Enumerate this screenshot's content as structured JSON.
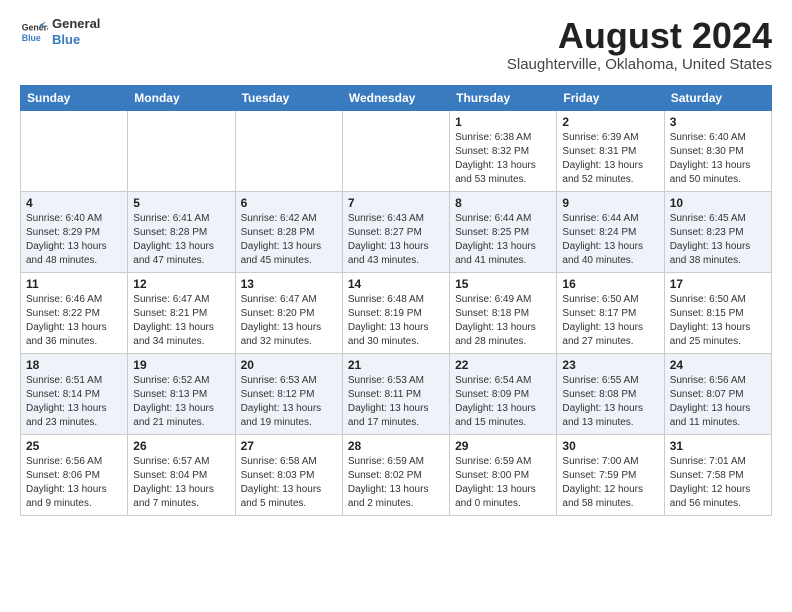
{
  "header": {
    "logo_line1": "General",
    "logo_line2": "Blue",
    "month_year": "August 2024",
    "location": "Slaughterville, Oklahoma, United States"
  },
  "weekdays": [
    "Sunday",
    "Monday",
    "Tuesday",
    "Wednesday",
    "Thursday",
    "Friday",
    "Saturday"
  ],
  "weeks": [
    [
      {
        "day": "",
        "info": ""
      },
      {
        "day": "",
        "info": ""
      },
      {
        "day": "",
        "info": ""
      },
      {
        "day": "",
        "info": ""
      },
      {
        "day": "1",
        "info": "Sunrise: 6:38 AM\nSunset: 8:32 PM\nDaylight: 13 hours\nand 53 minutes."
      },
      {
        "day": "2",
        "info": "Sunrise: 6:39 AM\nSunset: 8:31 PM\nDaylight: 13 hours\nand 52 minutes."
      },
      {
        "day": "3",
        "info": "Sunrise: 6:40 AM\nSunset: 8:30 PM\nDaylight: 13 hours\nand 50 minutes."
      }
    ],
    [
      {
        "day": "4",
        "info": "Sunrise: 6:40 AM\nSunset: 8:29 PM\nDaylight: 13 hours\nand 48 minutes."
      },
      {
        "day": "5",
        "info": "Sunrise: 6:41 AM\nSunset: 8:28 PM\nDaylight: 13 hours\nand 47 minutes."
      },
      {
        "day": "6",
        "info": "Sunrise: 6:42 AM\nSunset: 8:28 PM\nDaylight: 13 hours\nand 45 minutes."
      },
      {
        "day": "7",
        "info": "Sunrise: 6:43 AM\nSunset: 8:27 PM\nDaylight: 13 hours\nand 43 minutes."
      },
      {
        "day": "8",
        "info": "Sunrise: 6:44 AM\nSunset: 8:25 PM\nDaylight: 13 hours\nand 41 minutes."
      },
      {
        "day": "9",
        "info": "Sunrise: 6:44 AM\nSunset: 8:24 PM\nDaylight: 13 hours\nand 40 minutes."
      },
      {
        "day": "10",
        "info": "Sunrise: 6:45 AM\nSunset: 8:23 PM\nDaylight: 13 hours\nand 38 minutes."
      }
    ],
    [
      {
        "day": "11",
        "info": "Sunrise: 6:46 AM\nSunset: 8:22 PM\nDaylight: 13 hours\nand 36 minutes."
      },
      {
        "day": "12",
        "info": "Sunrise: 6:47 AM\nSunset: 8:21 PM\nDaylight: 13 hours\nand 34 minutes."
      },
      {
        "day": "13",
        "info": "Sunrise: 6:47 AM\nSunset: 8:20 PM\nDaylight: 13 hours\nand 32 minutes."
      },
      {
        "day": "14",
        "info": "Sunrise: 6:48 AM\nSunset: 8:19 PM\nDaylight: 13 hours\nand 30 minutes."
      },
      {
        "day": "15",
        "info": "Sunrise: 6:49 AM\nSunset: 8:18 PM\nDaylight: 13 hours\nand 28 minutes."
      },
      {
        "day": "16",
        "info": "Sunrise: 6:50 AM\nSunset: 8:17 PM\nDaylight: 13 hours\nand 27 minutes."
      },
      {
        "day": "17",
        "info": "Sunrise: 6:50 AM\nSunset: 8:15 PM\nDaylight: 13 hours\nand 25 minutes."
      }
    ],
    [
      {
        "day": "18",
        "info": "Sunrise: 6:51 AM\nSunset: 8:14 PM\nDaylight: 13 hours\nand 23 minutes."
      },
      {
        "day": "19",
        "info": "Sunrise: 6:52 AM\nSunset: 8:13 PM\nDaylight: 13 hours\nand 21 minutes."
      },
      {
        "day": "20",
        "info": "Sunrise: 6:53 AM\nSunset: 8:12 PM\nDaylight: 13 hours\nand 19 minutes."
      },
      {
        "day": "21",
        "info": "Sunrise: 6:53 AM\nSunset: 8:11 PM\nDaylight: 13 hours\nand 17 minutes."
      },
      {
        "day": "22",
        "info": "Sunrise: 6:54 AM\nSunset: 8:09 PM\nDaylight: 13 hours\nand 15 minutes."
      },
      {
        "day": "23",
        "info": "Sunrise: 6:55 AM\nSunset: 8:08 PM\nDaylight: 13 hours\nand 13 minutes."
      },
      {
        "day": "24",
        "info": "Sunrise: 6:56 AM\nSunset: 8:07 PM\nDaylight: 13 hours\nand 11 minutes."
      }
    ],
    [
      {
        "day": "25",
        "info": "Sunrise: 6:56 AM\nSunset: 8:06 PM\nDaylight: 13 hours\nand 9 minutes."
      },
      {
        "day": "26",
        "info": "Sunrise: 6:57 AM\nSunset: 8:04 PM\nDaylight: 13 hours\nand 7 minutes."
      },
      {
        "day": "27",
        "info": "Sunrise: 6:58 AM\nSunset: 8:03 PM\nDaylight: 13 hours\nand 5 minutes."
      },
      {
        "day": "28",
        "info": "Sunrise: 6:59 AM\nSunset: 8:02 PM\nDaylight: 13 hours\nand 2 minutes."
      },
      {
        "day": "29",
        "info": "Sunrise: 6:59 AM\nSunset: 8:00 PM\nDaylight: 13 hours\nand 0 minutes."
      },
      {
        "day": "30",
        "info": "Sunrise: 7:00 AM\nSunset: 7:59 PM\nDaylight: 12 hours\nand 58 minutes."
      },
      {
        "day": "31",
        "info": "Sunrise: 7:01 AM\nSunset: 7:58 PM\nDaylight: 12 hours\nand 56 minutes."
      }
    ]
  ]
}
